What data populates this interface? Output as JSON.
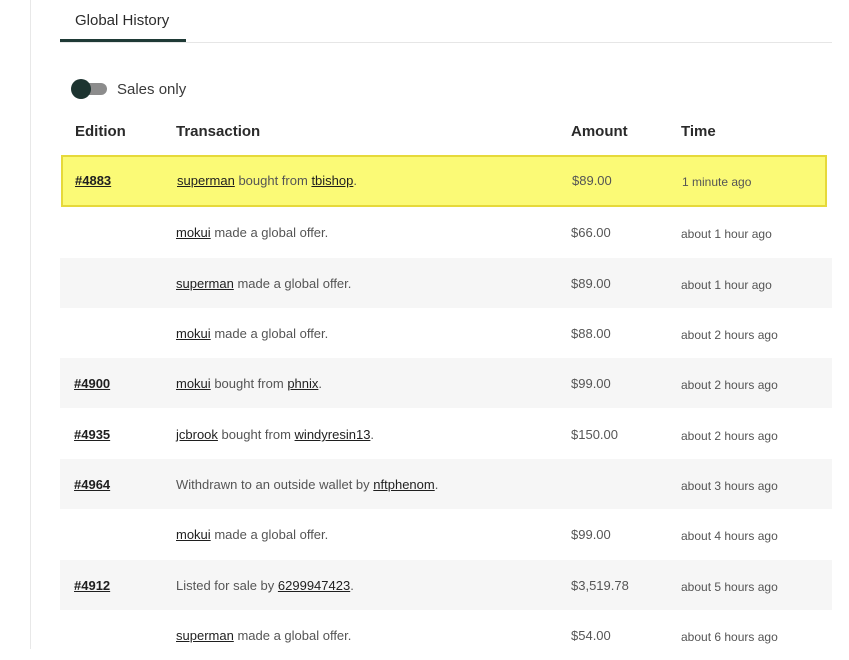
{
  "tabs": [
    {
      "label": "Global History"
    }
  ],
  "filter": {
    "label": "Sales only",
    "enabled": false
  },
  "table": {
    "headers": {
      "edition": "Edition",
      "transaction": "Transaction",
      "amount": "Amount",
      "time": "Time"
    },
    "rows": [
      {
        "edition": "#4883",
        "user": "superman",
        "action": "bought from",
        "target": "tbishop",
        "end": ".",
        "amount": "$89.00",
        "time": "1 minute ago"
      },
      {
        "edition": "",
        "user": "mokui",
        "action": "made a global offer.",
        "target": "",
        "end": "",
        "amount": "$66.00",
        "time": "about 1 hour ago"
      },
      {
        "edition": "",
        "user": "superman",
        "action": "made a global offer.",
        "target": "",
        "end": "",
        "amount": "$89.00",
        "time": "about 1 hour ago"
      },
      {
        "edition": "",
        "user": "mokui",
        "action": "made a global offer.",
        "target": "",
        "end": "",
        "amount": "$88.00",
        "time": "about 2 hours ago"
      },
      {
        "edition": "#4900",
        "user": "mokui",
        "action": "bought from",
        "target": "phnix",
        "end": ".",
        "amount": "$99.00",
        "time": "about 2 hours ago"
      },
      {
        "edition": "#4935",
        "user": "jcbrook",
        "action": "bought from",
        "target": "windyresin13",
        "end": ".",
        "amount": "$150.00",
        "time": "about 2 hours ago"
      },
      {
        "edition": "#4964",
        "user": "",
        "action": "Withdrawn to an outside wallet by",
        "target": "nftphenom",
        "end": ".",
        "amount": "",
        "time": "about 3 hours ago"
      },
      {
        "edition": "",
        "user": "mokui",
        "action": "made a global offer.",
        "target": "",
        "end": "",
        "amount": "$99.00",
        "time": "about 4 hours ago"
      },
      {
        "edition": "#4912",
        "user": "",
        "action": "Listed for sale by",
        "target": "6299947423",
        "end": ".",
        "amount": "$3,519.78",
        "time": "about 5 hours ago"
      },
      {
        "edition": "",
        "user": "superman",
        "action": "made a global offer.",
        "target": "",
        "end": "",
        "amount": "$54.00",
        "time": "about 6 hours ago"
      }
    ]
  }
}
